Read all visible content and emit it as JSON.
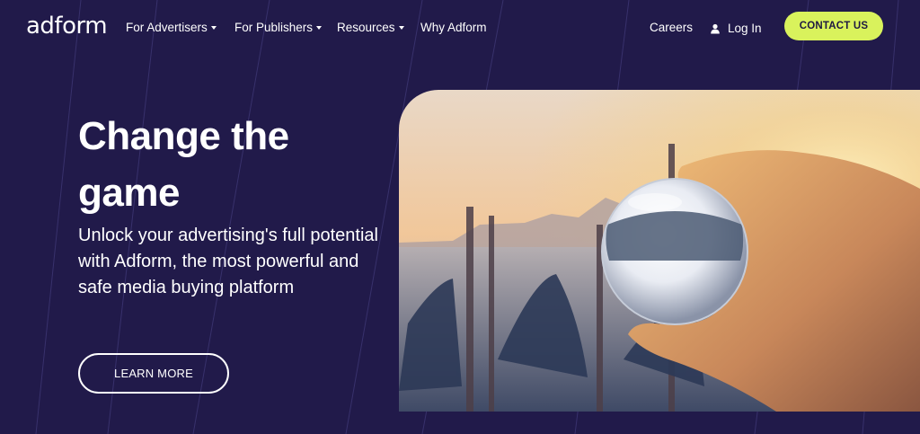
{
  "brand": {
    "logo_text": "adform"
  },
  "nav": {
    "items": [
      {
        "label": "For Advertisers",
        "has_dropdown": true
      },
      {
        "label": "For Publishers",
        "has_dropdown": true
      },
      {
        "label": "Resources",
        "has_dropdown": true
      },
      {
        "label": "Why Adform",
        "has_dropdown": false
      }
    ],
    "careers": "Careers",
    "login": "Log In",
    "contact": "CONTACT US"
  },
  "hero": {
    "title": "Change the game",
    "subtitle": "Unlock your advertising's full potential with Adform, the most powerful and safe media buying platform",
    "cta": "LEARN MORE"
  },
  "colors": {
    "background": "#211a4a",
    "accent": "#d9f25c",
    "text": "#ffffff"
  },
  "icons": [
    "caret-down-icon",
    "user-icon"
  ]
}
